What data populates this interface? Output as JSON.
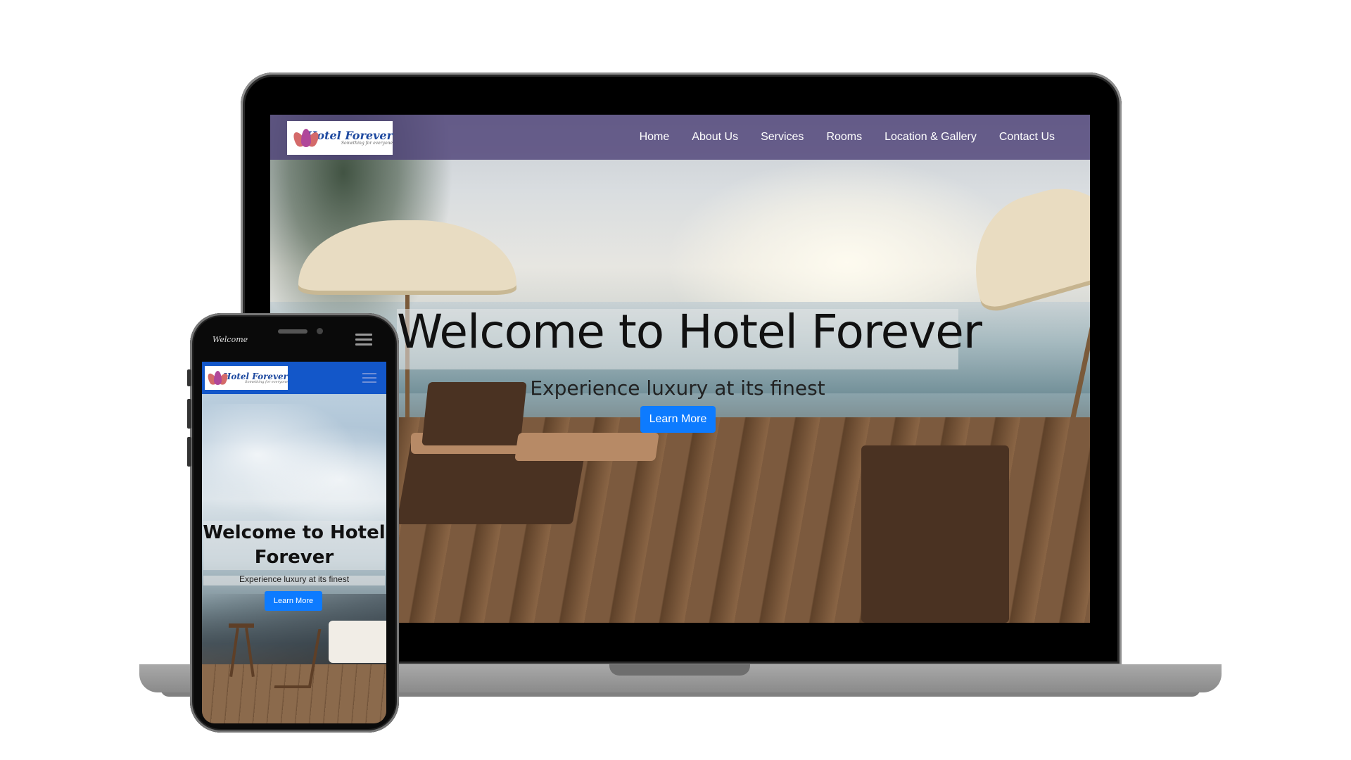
{
  "desktop": {
    "logo": {
      "name": "Hotel Forever",
      "tagline": "Something for everyone"
    },
    "nav": [
      {
        "label": "Home"
      },
      {
        "label": "About Us"
      },
      {
        "label": "Services"
      },
      {
        "label": "Rooms"
      },
      {
        "label": "Location & Gallery"
      },
      {
        "label": "Contact Us"
      }
    ],
    "hero": {
      "title": "Welcome to Hotel Forever",
      "subtitle": "Experience luxury at its finest",
      "button": "Learn More"
    },
    "colors": {
      "nav_bg": "#4e4278",
      "button": "#0d7bff"
    }
  },
  "mobile": {
    "status_text": "Welcome",
    "logo": {
      "name": "Hotel Forever",
      "tagline": "Something for everyone"
    },
    "hero": {
      "title": "Welcome to Hotel Forever",
      "subtitle": "Experience luxury at its finest",
      "button": "Learn More"
    },
    "colors": {
      "nav_bg": "#1357c9",
      "button": "#0d7bff"
    }
  },
  "icons": [
    "lotus-logo-icon",
    "hamburger-menu-icon"
  ]
}
